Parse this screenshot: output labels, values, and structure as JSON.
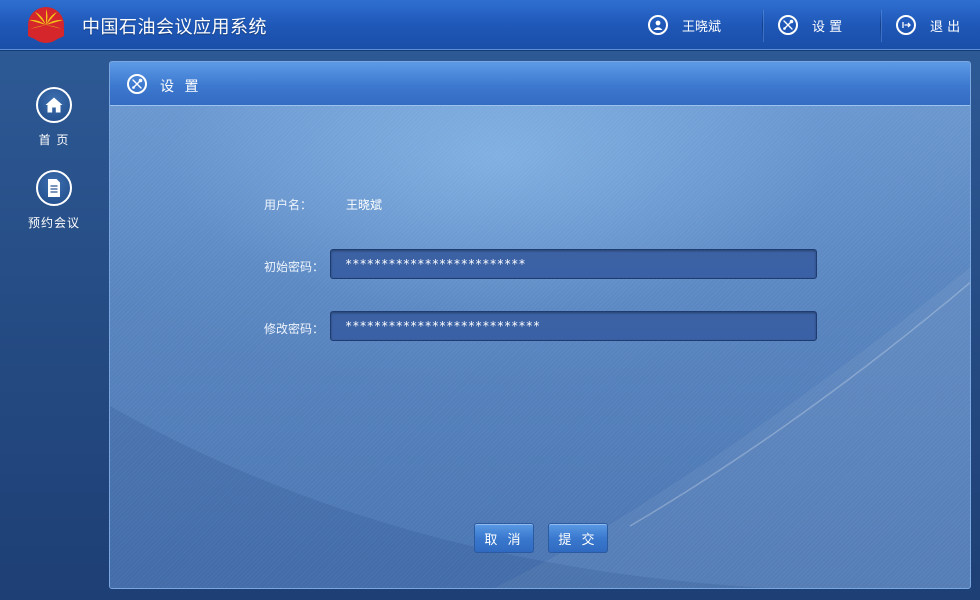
{
  "app": {
    "title": "中国石油会议应用系统"
  },
  "header": {
    "user_name": "王晓斌",
    "settings_label": "设 置",
    "logout_label": "退 出"
  },
  "sidebar": {
    "items": [
      {
        "label": "首 页",
        "icon": "home-icon"
      },
      {
        "label": "预约会议",
        "icon": "document-icon"
      }
    ]
  },
  "panel": {
    "title": "设 置",
    "icon": "settings-icon"
  },
  "form": {
    "username_label": "用户名：",
    "username_value": "王晓斌",
    "initial_password_label": "初始密码：",
    "initial_password_value": "*************************",
    "new_password_label": "修改密码：",
    "new_password_value": "***************************"
  },
  "buttons": {
    "cancel_label": "取 消",
    "submit_label": "提 交"
  },
  "colors": {
    "topbar": "#1f58b8",
    "background": "#284f88",
    "panel": "#5a86c0",
    "button": "#3a79cf",
    "logo_red": "#d4262b",
    "logo_yellow": "#f4c21a"
  }
}
